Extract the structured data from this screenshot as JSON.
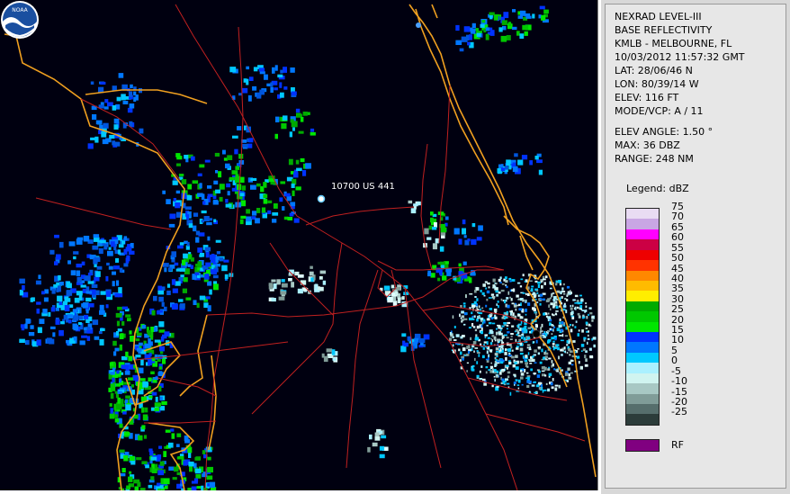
{
  "station_info": {
    "line1": "NEXRAD LEVEL-III",
    "line2": "BASE REFLECTIVITY",
    "site": "KMLB - MELBOURNE, FL",
    "datetime": "10/03/2012 11:57:32 GMT",
    "lat": "LAT: 28/06/46 N",
    "lon": "LON: 80/39/14 W",
    "elev": "ELEV: 116 FT",
    "mode": "MODE/VCP: A / 11",
    "elev_angle": "ELEV ANGLE: 1.50 °",
    "max": "MAX: 36 DBZ",
    "range": "RANGE: 248 NM"
  },
  "legend": {
    "title": "Legend: dBZ",
    "levels": [
      {
        "label": "75",
        "color": "#e9dcf3"
      },
      {
        "label": "70",
        "color": "#c9a6e4"
      },
      {
        "label": "65",
        "color": "#ff00ff"
      },
      {
        "label": "60",
        "color": "#cc0044"
      },
      {
        "label": "55",
        "color": "#ee0000"
      },
      {
        "label": "50",
        "color": "#ff3300"
      },
      {
        "label": "45",
        "color": "#ff8800"
      },
      {
        "label": "40",
        "color": "#ffbb00"
      },
      {
        "label": "35",
        "color": "#ffee00"
      },
      {
        "label": "30",
        "color": "#00aa00"
      },
      {
        "label": "25",
        "color": "#00c800"
      },
      {
        "label": "20",
        "color": "#00e600"
      },
      {
        "label": "15",
        "color": "#0033ff"
      },
      {
        "label": "10",
        "color": "#0077ff"
      },
      {
        "label": "5",
        "color": "#00c8ff"
      },
      {
        "label": "0",
        "color": "#aaf0ff"
      },
      {
        "label": "-5",
        "color": "#d0f4f0"
      },
      {
        "label": "-10",
        "color": "#a8c8c4"
      },
      {
        "label": "-15",
        "color": "#809c98"
      },
      {
        "label": "-20",
        "color": "#566e6c"
      },
      {
        "label": "-25",
        "color": "#2c3c3a"
      }
    ],
    "rf_label": "RF",
    "rf_color": "#800080"
  },
  "map": {
    "marker_label": "10700 US 441",
    "radar_site_label": "",
    "colors": {
      "background": "#000010",
      "coast": "#f0a020",
      "roads": "#c02020",
      "marker": "#66ccff"
    }
  },
  "logo": {
    "name": "noaa-logo",
    "text": "NOAA"
  }
}
